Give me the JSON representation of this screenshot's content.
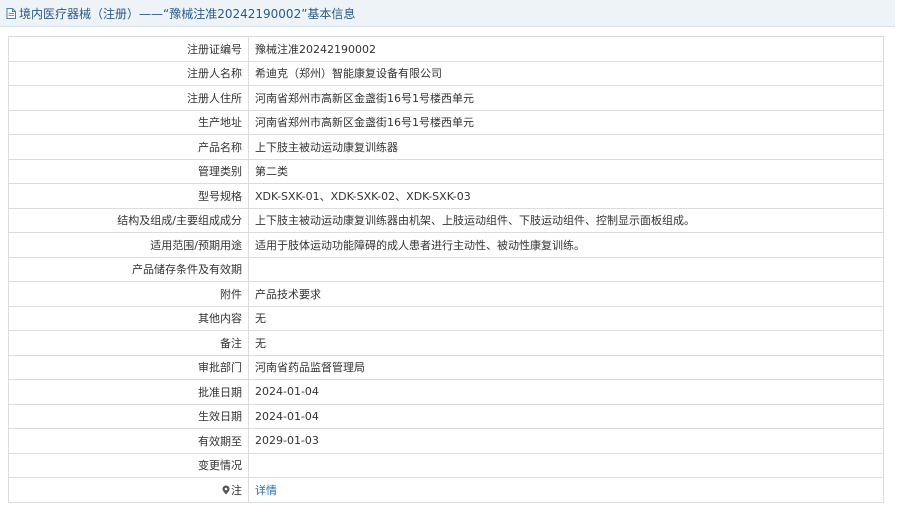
{
  "header": {
    "title": "境内医疗器械（注册）——“豫械注准20242190002”基本信息",
    "icon": "document-icon"
  },
  "rows": [
    {
      "label": "注册证编号",
      "value": "豫械注准20242190002"
    },
    {
      "label": "注册人名称",
      "value": "希迪克（郑州）智能康复设备有限公司"
    },
    {
      "label": "注册人住所",
      "value": "河南省郑州市高新区金盏街16号1号楼西单元"
    },
    {
      "label": "生产地址",
      "value": "河南省郑州市高新区金盏街16号1号楼西单元"
    },
    {
      "label": "产品名称",
      "value": "上下肢主被动运动康复训练器"
    },
    {
      "label": "管理类别",
      "value": "第二类"
    },
    {
      "label": "型号规格",
      "value": "XDK-SXK-01、XDK-SXK-02、XDK-SXK-03"
    },
    {
      "label": "结构及组成/主要组成成分",
      "value": "上下肢主被动运动康复训练器由机架、上肢运动组件、下肢运动组件、控制显示面板组成。"
    },
    {
      "label": "适用范围/预期用途",
      "value": "适用于肢体运动功能障碍的成人患者进行主动性、被动性康复训练。"
    },
    {
      "label": "产品储存条件及有效期",
      "value": ""
    },
    {
      "label": "附件",
      "value": "产品技术要求"
    },
    {
      "label": "其他内容",
      "value": "无"
    },
    {
      "label": "备注",
      "value": "无"
    },
    {
      "label": "审批部门",
      "value": "河南省药品监督管理局"
    },
    {
      "label": "批准日期",
      "value": "2024-01-04"
    },
    {
      "label": "生效日期",
      "value": "2024-01-04"
    },
    {
      "label": "有效期至",
      "value": "2029-01-03"
    },
    {
      "label": "变更情况",
      "value": ""
    }
  ],
  "footer_row": {
    "label": "注",
    "icon": "pin-icon",
    "link_text": "详情"
  },
  "colors": {
    "title_text": "#2b5a86",
    "title_bg": "#eef3f8",
    "link": "#2b6cb0",
    "border": "#dcdcdc"
  }
}
